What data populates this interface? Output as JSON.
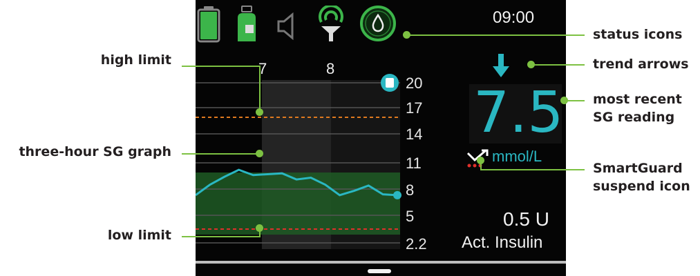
{
  "status": {
    "time": "09:00",
    "icons": [
      "battery-icon",
      "reservoir-icon",
      "speaker-muted-icon",
      "sensor-connection-icon",
      "smartguard-drop-icon"
    ]
  },
  "graph": {
    "x_ticks": [
      "7",
      "8"
    ],
    "y_ticks": [
      "20",
      "17",
      "14",
      "11",
      "8",
      "5",
      "2.2"
    ],
    "high_limit": 17,
    "low_limit": 3.3,
    "sg_trace": [
      7.3,
      8.5,
      9.4,
      10.2,
      9.6,
      9.7,
      9.8,
      9.1,
      9.3,
      8.5,
      7.3,
      7.8,
      8.4,
      7.4,
      7.3
    ]
  },
  "reading": {
    "value": "7.5",
    "unit": "mmol/L",
    "trend": "down-arrow-icon"
  },
  "insulin": {
    "value": "0.5 U",
    "label": "Act. Insulin"
  },
  "callouts": {
    "high_limit": "high limit",
    "sg_graph": "three-hour SG graph",
    "low_limit": "low limit",
    "status_icons": "status icons",
    "trend_arrows": "trend arrows",
    "recent_sg_line1": "most recent",
    "recent_sg_line2": "SG reading",
    "smartguard_line1": "SmartGuard",
    "smartguard_line2": "suspend icon"
  },
  "colors": {
    "accent": "#2ab7c2",
    "callout_green": "#7dc142",
    "battery_green": "#3cb54a",
    "high_limit": "#e07a1f",
    "low_limit": "#e0302b",
    "target_band": "#1e5a25"
  }
}
